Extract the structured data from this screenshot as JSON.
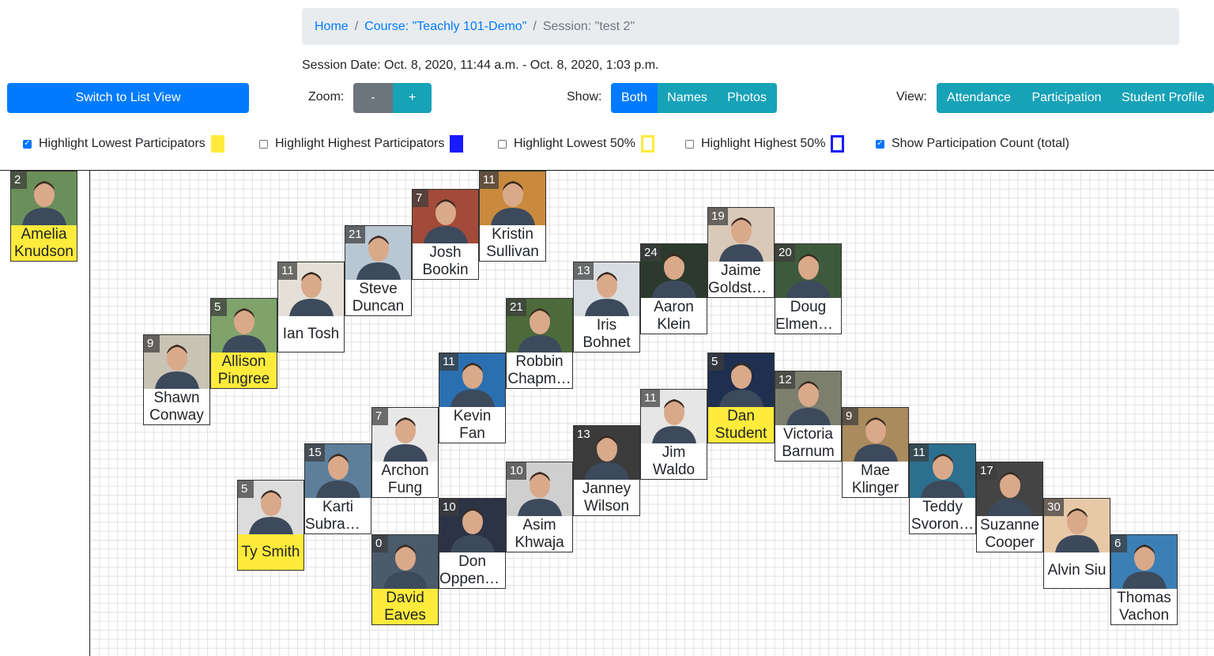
{
  "breadcrumb": {
    "home": "Home",
    "course": "Course: \"Teachly 101-Demo\"",
    "session": "Session: \"test 2\""
  },
  "session_date": "Session Date: Oct. 8, 2020, 11:44 a.m. - Oct. 8, 2020, 1:03 p.m.",
  "toolbar": {
    "switch_view": "Switch to List View",
    "zoom_label": "Zoom:",
    "zoom_out": "-",
    "zoom_in": "+",
    "show_label": "Show:",
    "show_options": [
      "Both",
      "Names",
      "Photos"
    ],
    "show_selected": "Both",
    "view_label": "View:",
    "view_options": [
      "Attendance",
      "Participation",
      "Student Profile"
    ]
  },
  "checkboxes": [
    {
      "label": "Highlight Lowest Participators",
      "checked": true,
      "swatch": "#ffeb3b",
      "swatch_style": "filled"
    },
    {
      "label": "Highlight Highest Participators",
      "checked": false,
      "swatch": "#1a1aff",
      "swatch_style": "filled"
    },
    {
      "label": "Highlight Lowest 50%",
      "checked": false,
      "swatch": "#ffeb3b",
      "swatch_style": "outline"
    },
    {
      "label": "Highlight Highest 50%",
      "checked": false,
      "swatch": "#1a1aff",
      "swatch_style": "outline"
    },
    {
      "label": "Show Participation Count (total)",
      "checked": true
    }
  ],
  "colors": {
    "primary": "#007bff",
    "info": "#17a2b8",
    "secondary": "#6c757d",
    "highlight_low": "#ffeb3b",
    "highlight_high": "#1a1aff"
  },
  "students": [
    {
      "first": "Amelia",
      "last": "Knudson",
      "count": "2",
      "low": true,
      "unseated": true
    },
    {
      "first": "Shawn",
      "last": "Conway",
      "count": "9",
      "low": false
    },
    {
      "first": "Allison",
      "last": "Pingree",
      "count": "5",
      "low": true
    },
    {
      "first": "",
      "last": "Ian Tosh",
      "count": "11",
      "low": false
    },
    {
      "first": "Steve",
      "last": "Duncan",
      "count": "21",
      "low": false
    },
    {
      "first": "Josh",
      "last": "Bookin",
      "count": "7",
      "low": false
    },
    {
      "first": "Kristin",
      "last": "Sullivan",
      "count": "11",
      "low": false
    },
    {
      "first": "Robbin",
      "last": "Chapm…",
      "count": "21",
      "low": false
    },
    {
      "first": "Iris",
      "last": "Bohnet",
      "count": "13",
      "low": false
    },
    {
      "first": "Aaron",
      "last": "Klein",
      "count": "24",
      "low": false
    },
    {
      "first": "Jaime",
      "last": "Goldste…",
      "count": "19",
      "low": false
    },
    {
      "first": "Doug",
      "last": "Elmend…",
      "count": "20",
      "low": false
    },
    {
      "first": "Kevin",
      "last": "Fan",
      "count": "11",
      "low": false
    },
    {
      "first": "Archon",
      "last": "Fung",
      "count": "7",
      "low": false
    },
    {
      "first": "Karti",
      "last": "Subram…",
      "count": "15",
      "low": false
    },
    {
      "first": "",
      "last": "Ty Smith",
      "count": "5",
      "low": true
    },
    {
      "first": "David",
      "last": "Eaves",
      "count": "0",
      "low": true
    },
    {
      "first": "Don",
      "last": "Oppenh…",
      "count": "10",
      "low": false
    },
    {
      "first": "Asim",
      "last": "Khwaja",
      "count": "10",
      "low": false
    },
    {
      "first": "Janney",
      "last": "Wilson",
      "count": "13",
      "low": false
    },
    {
      "first": "Jim",
      "last": "Waldo",
      "count": "11",
      "low": false
    },
    {
      "first": "Dan",
      "last": "Student",
      "count": "5",
      "low": true
    },
    {
      "first": "Victoria",
      "last": "Barnum",
      "count": "12",
      "low": false
    },
    {
      "first": "Mae",
      "last": "Klinger",
      "count": "9",
      "low": false
    },
    {
      "first": "Teddy",
      "last": "Svoron…",
      "count": "11",
      "low": false
    },
    {
      "first": "Suzanne",
      "last": "Cooper",
      "count": "17",
      "low": false
    },
    {
      "first": "",
      "last": "Alvin Siu",
      "count": "30",
      "low": false
    },
    {
      "first": "Thomas",
      "last": "Vachon",
      "count": "6",
      "low": false
    }
  ]
}
